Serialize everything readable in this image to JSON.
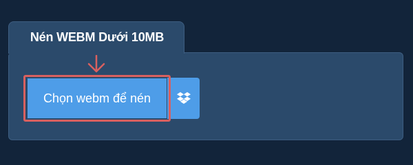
{
  "tab": {
    "title": "Nén WEBM Dưới 10MB"
  },
  "buttons": {
    "choose_label": "Chọn webm để nén",
    "dropbox_icon": "dropbox-icon"
  },
  "colors": {
    "page_background": "#12243a",
    "panel_background": "#2b4a6b",
    "button_blue": "#4e9de8",
    "highlight_red": "#d9605f"
  }
}
